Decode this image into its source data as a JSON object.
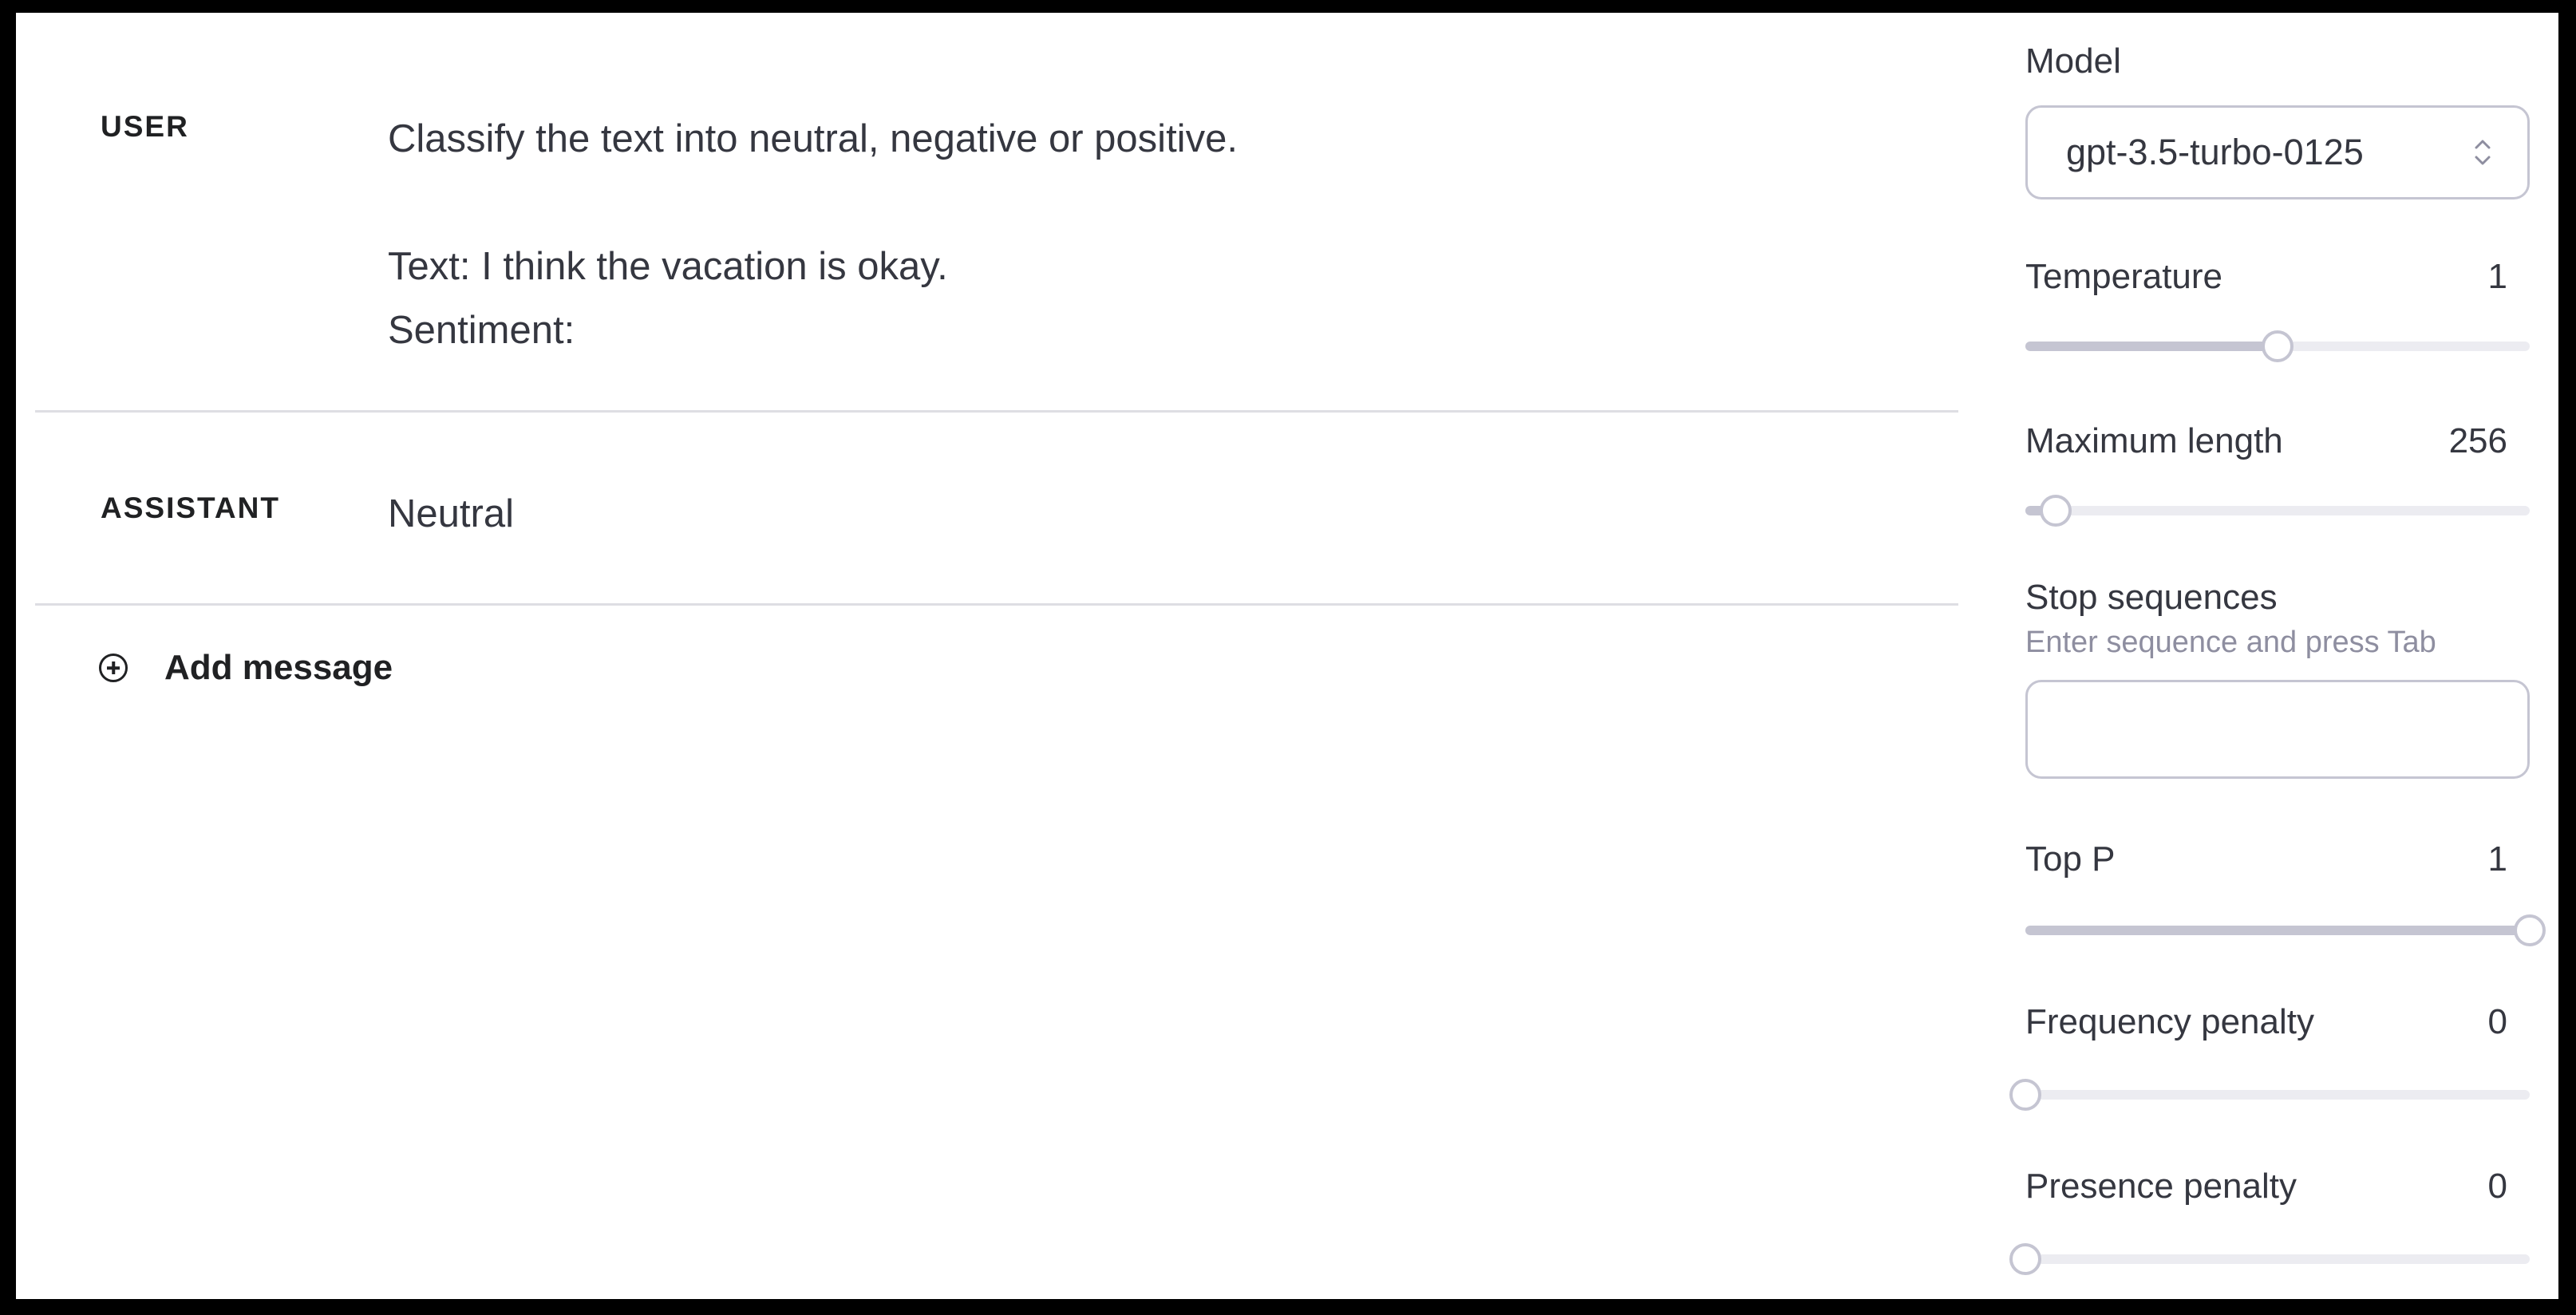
{
  "messages": [
    {
      "role": "USER",
      "lines": [
        "Classify the text into neutral, negative or positive.",
        "",
        "Text: I think the vacation is okay.",
        "Sentiment:"
      ]
    },
    {
      "role": "ASSISTANT",
      "lines": [
        "Neutral"
      ]
    }
  ],
  "add_message_label": "Add message",
  "settings": {
    "model": {
      "label": "Model",
      "value": "gpt-3.5-turbo-0125"
    },
    "temperature": {
      "label": "Temperature",
      "value": "1",
      "fraction": 0.5
    },
    "max_length": {
      "label": "Maximum length",
      "value": "256",
      "fraction": 0.06
    },
    "stop_sequences": {
      "label": "Stop sequences",
      "hint": "Enter sequence and press Tab",
      "value": ""
    },
    "top_p": {
      "label": "Top P",
      "value": "1",
      "fraction": 1.0
    },
    "frequency_penalty": {
      "label": "Frequency penalty",
      "value": "0",
      "fraction": 0.0
    },
    "presence_penalty": {
      "label": "Presence penalty",
      "value": "0",
      "fraction": 0.0
    }
  },
  "icons": {
    "add": "plus-circle-icon",
    "select": "chevron-up-down-icon"
  },
  "colors": {
    "track": "#ececf1",
    "fill": "#c5c5d2",
    "border": "#c5c5d2",
    "hint": "#8e8ea0"
  }
}
